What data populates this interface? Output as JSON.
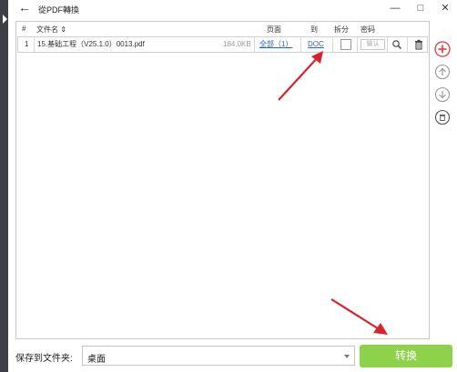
{
  "window": {
    "title": "從PDF轉換",
    "back_glyph": "←",
    "minimize_glyph": "—",
    "maximize_glyph": "□",
    "close_glyph": "✕"
  },
  "table": {
    "headers": {
      "index": "#",
      "filename": "文件名 ⇕",
      "pages": "页面",
      "to": "到",
      "split": "拆分",
      "password": "密码"
    },
    "rows": [
      {
        "index": "1",
        "filename": "15.基础工程（V25.1.0）0013.pdf",
        "size": "184.0KB",
        "pages": "全部（1）",
        "format": "DOC",
        "split": false,
        "password_placeholder": "输认"
      }
    ]
  },
  "bottom": {
    "save_label": "保存到文件夹:",
    "folder_value": "桌面",
    "convert_label": "转换"
  },
  "colors": {
    "accent_green": "#8ed14a",
    "add_red": "#e53935",
    "link_blue": "#2a64c5",
    "arrow_red": "#d9232c"
  },
  "icons": {
    "row": [
      "search-icon",
      "trash-icon"
    ],
    "side": [
      "add-icon",
      "move-up-icon",
      "move-down-icon",
      "delete-icon"
    ]
  }
}
